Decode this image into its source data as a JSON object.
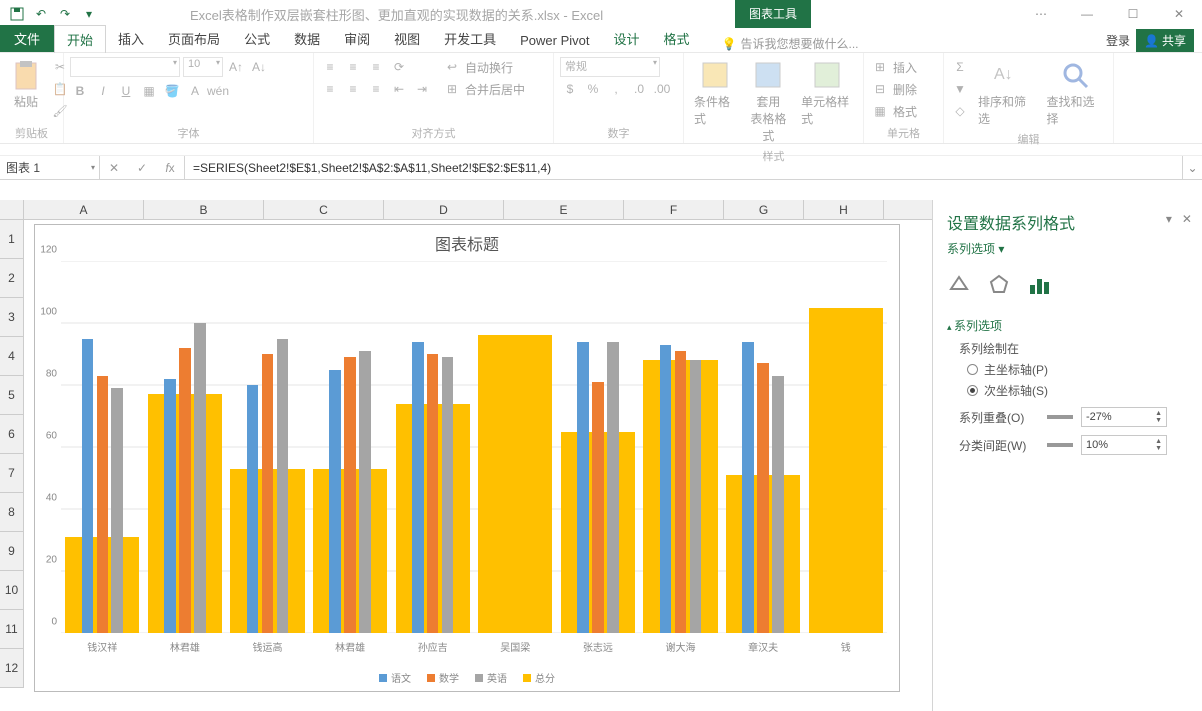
{
  "titlebar": {
    "title": "Excel表格制作双层嵌套柱形图、更加直观的实现数据的关系.xlsx - Excel",
    "chart_tools": "图表工具"
  },
  "tabs": {
    "file": "文件",
    "home": "开始",
    "insert": "插入",
    "layout": "页面布局",
    "formulas": "公式",
    "data": "数据",
    "review": "审阅",
    "view": "视图",
    "dev": "开发工具",
    "powerpivot": "Power Pivot",
    "design": "设计",
    "format": "格式",
    "tell": "告诉我您想要做什么...",
    "login": "登录",
    "share": "共享"
  },
  "ribbon": {
    "clipboard": {
      "label": "剪贴板",
      "paste": "粘贴"
    },
    "font": {
      "label": "字体",
      "size": "10"
    },
    "align": {
      "label": "对齐方式",
      "wrap": "自动换行",
      "merge": "合并后居中"
    },
    "number": {
      "label": "数字",
      "format": "常规"
    },
    "styles": {
      "label": "样式",
      "cond": "条件格式",
      "table": "套用\n表格格式",
      "cell": "单元格样式"
    },
    "cells": {
      "label": "单元格",
      "insert": "插入",
      "delete": "删除",
      "format": "格式"
    },
    "editing": {
      "label": "编辑",
      "sort": "排序和筛选",
      "find": "查找和选择"
    }
  },
  "formula_bar": {
    "name": "图表 1",
    "formula": "=SERIES(Sheet2!$E$1,Sheet2!$A$2:$A$11,Sheet2!$E$2:$E$11,4)"
  },
  "columns": [
    "A",
    "B",
    "C",
    "D",
    "E",
    "F",
    "G",
    "H"
  ],
  "rows": [
    "1",
    "2",
    "3",
    "4",
    "5",
    "6",
    "7",
    "8",
    "9",
    "10",
    "11",
    "12"
  ],
  "chart_data": {
    "type": "bar",
    "title": "图表标题",
    "ylim": [
      0,
      120
    ],
    "yticks": [
      0,
      20,
      40,
      60,
      80,
      100,
      120
    ],
    "categories": [
      "钱汉祥",
      "林君雄",
      "钱运高",
      "林君雄",
      "孙应吉",
      "吴国梁",
      "张志远",
      "谢大海",
      "章汉夫",
      "钱"
    ],
    "series": [
      {
        "name": "语文",
        "color": "#5b9bd5",
        "values": [
          95,
          82,
          80,
          85,
          94,
          null,
          94,
          93,
          94,
          null
        ]
      },
      {
        "name": "数学",
        "color": "#ed7d31",
        "values": [
          83,
          92,
          90,
          89,
          90,
          null,
          81,
          91,
          87,
          null
        ]
      },
      {
        "name": "英语",
        "color": "#a5a5a5",
        "values": [
          79,
          100,
          95,
          91,
          89,
          null,
          94,
          88,
          83,
          null
        ]
      },
      {
        "name": "总分",
        "color": "#ffc000",
        "values": [
          31,
          77,
          53,
          53,
          74,
          96,
          65,
          88,
          51,
          105
        ]
      }
    ],
    "legend": [
      "语文",
      "数学",
      "英语",
      "总分"
    ]
  },
  "panel": {
    "title": "设置数据系列格式",
    "subtitle": "系列选项",
    "section": "系列选项",
    "plot_on": "系列绘制在",
    "primary": "主坐标轴(P)",
    "secondary": "次坐标轴(S)",
    "overlap_label": "系列重叠(O)",
    "overlap_value": "-27%",
    "gap_label": "分类间距(W)",
    "gap_value": "10%"
  }
}
